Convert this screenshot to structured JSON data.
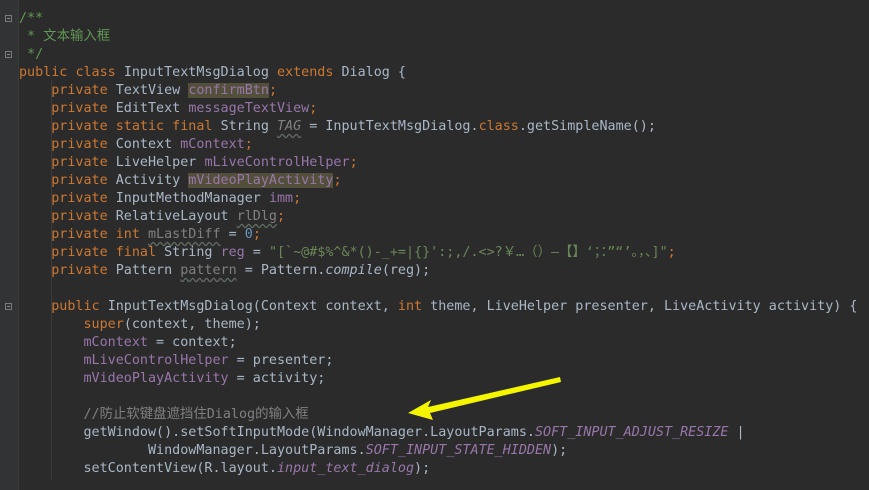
{
  "code": {
    "l1_doc_start": "/**",
    "l2_doc_text": " * 文本输入框",
    "l3_doc_end": " */",
    "l4": {
      "kw_public": "public",
      "kw_class": "class",
      "class_name": "InputTextMsgDialog",
      "kw_extends": "extends",
      "parent": "Dialog {"
    },
    "l5": {
      "kw": "private",
      "type": "TextView",
      "field": "confirmBtn",
      "end": ";"
    },
    "l6": {
      "kw": "private",
      "type": "EditText",
      "field": "messageTextView",
      "end": ";"
    },
    "l7": {
      "kw": "private static final",
      "type": "String",
      "field": "TAG",
      "mid": " = InputTextMsgDialog.",
      "kw2": "class",
      "end": ".getSimpleName();"
    },
    "l8": {
      "kw": "private",
      "type": "Context",
      "field": "mContext",
      "end": ";"
    },
    "l9": {
      "kw": "private",
      "type": "LiveHelper",
      "field": "mLiveControlHelper",
      "end": ";"
    },
    "l10": {
      "kw": "private",
      "type": "Activity",
      "field": "mVideoPlayActivity",
      "end": ";"
    },
    "l11": {
      "kw": "private",
      "type": "InputMethodManager",
      "field": "imm",
      "end": ";"
    },
    "l12": {
      "kw": "private",
      "type": "RelativeLayout",
      "field": "rlDlg",
      "end": ";"
    },
    "l13": {
      "kw": "private int",
      "field": "mLastDiff",
      "mid": " = ",
      "num": "0",
      "end": ";"
    },
    "l14": {
      "kw": "private final",
      "type": "String",
      "field": "reg",
      "mid": " = ",
      "str": "\"[`~@#$%^&*()-_+=|{}':;,/.<>?￥…（）—【】‘；：”“’。，、]\"",
      "end": ";"
    },
    "l15": {
      "kw": "private",
      "type": "Pattern",
      "field": "pattern",
      "mid": " = Pattern.",
      "call": "compile",
      "end": "(reg);"
    },
    "l17": {
      "kw_public": "public",
      "sig_a": "InputTextMsgDialog(Context context, ",
      "kw_int": "int",
      "sig_b": " theme, LiveHelper presenter, LiveActivity activity) {"
    },
    "l18": {
      "kw": "super",
      "end": "(context, theme);"
    },
    "l19": {
      "field": "mContext",
      "end": " = context;"
    },
    "l20": {
      "field": "mLiveControlHelper",
      "end": " = presenter;"
    },
    "l21": {
      "field": "mVideoPlayActivity",
      "end": " = activity;"
    },
    "l23_comment": "//防止软键盘遮挡住Dialog的输入框",
    "l24": {
      "pre": "getWindow().setSoftInputMode(WindowManager.LayoutParams.",
      "const": "SOFT_INPUT_ADJUST_RESIZE",
      "end": " |"
    },
    "l25": {
      "pre": "WindowManager.LayoutParams.",
      "const": "SOFT_INPUT_STATE_HIDDEN",
      "end": ");"
    },
    "l26": {
      "pre": "setContentView(R.layout.",
      "const": "input_text_dialog",
      "end": ");"
    }
  },
  "colors": {
    "background": "#2b2b2b",
    "keyword": "#cc7832",
    "field": "#9876aa",
    "comment": "#808080",
    "doc_comment": "#629755",
    "string": "#6a8759",
    "number": "#6897bb",
    "text": "#a9b7c6",
    "arrow": "#f5f500"
  }
}
